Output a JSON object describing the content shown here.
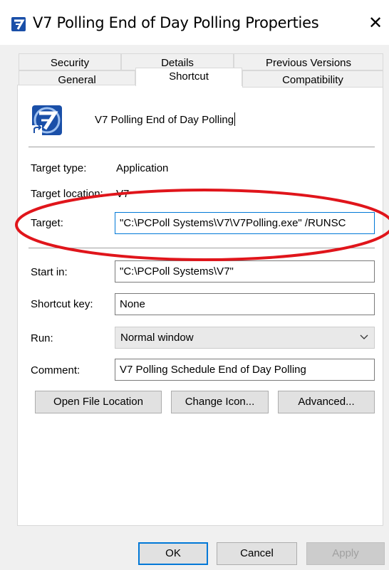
{
  "window": {
    "title": "V7 Polling End of Day Polling Properties",
    "close_symbol": "✕"
  },
  "tabs": {
    "row1": [
      "Security",
      "Details",
      "Previous Versions"
    ],
    "row2": [
      "General",
      "Shortcut",
      "Compatibility"
    ],
    "selected": "Shortcut"
  },
  "shortcut": {
    "name": "V7 Polling End of Day Polling",
    "target_type_label": "Target type:",
    "target_type_value": "Application",
    "target_location_label": "Target location:",
    "target_location_value": "V7",
    "target_label": "Target:",
    "target_value": "\"C:\\PCPoll Systems\\V7\\V7Polling.exe\" /RUNSC",
    "start_in_label": "Start in:",
    "start_in_value": "\"C:\\PCPoll Systems\\V7\"",
    "shortcut_key_label": "Shortcut key:",
    "shortcut_key_value": "None",
    "run_label": "Run:",
    "run_value": "Normal window",
    "comment_label": "Comment:",
    "comment_value": "V7 Polling Schedule End of Day Polling"
  },
  "buttons": {
    "open_file_location": "Open File Location",
    "change_icon": "Change Icon...",
    "advanced": "Advanced...",
    "ok": "OK",
    "cancel": "Cancel",
    "apply": "Apply"
  },
  "colors": {
    "icon_blue": "#1a4fa8",
    "annotation_red": "#e0151b",
    "focus_blue": "#0078d7"
  },
  "icons": {
    "app": "v7-logo-icon",
    "dropdown": "chevron-down-icon"
  }
}
